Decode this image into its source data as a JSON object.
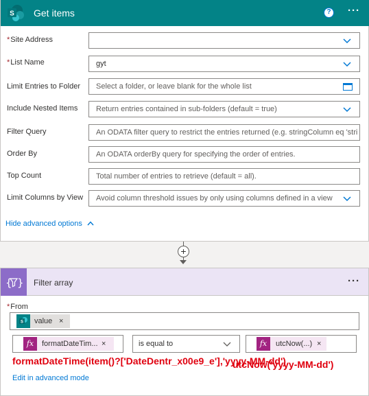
{
  "get_items": {
    "title": "Get items",
    "help_glyph": "?",
    "more_glyph": "···",
    "required_mark": "*",
    "fields": {
      "site_address": {
        "label": "Site Address",
        "value": ""
      },
      "list_name": {
        "label": "List Name",
        "value": "gyt"
      },
      "limit_folder": {
        "label": "Limit Entries to Folder",
        "placeholder": "Select a folder, or leave blank for the whole list"
      },
      "nested_items": {
        "label": "Include Nested Items",
        "placeholder": "Return entries contained in sub-folders (default = true)"
      },
      "filter_query": {
        "label": "Filter Query",
        "placeholder": "An ODATA filter query to restrict the entries returned (e.g. stringColumn eq 'stri"
      },
      "order_by": {
        "label": "Order By",
        "placeholder": "An ODATA orderBy query for specifying the order of entries."
      },
      "top_count": {
        "label": "Top Count",
        "placeholder": "Total number of entries to retrieve (default = all)."
      },
      "limit_columns": {
        "label": "Limit Columns by View",
        "placeholder": "Avoid column threshold issues by only using columns defined in a view"
      }
    },
    "hide_advanced": "Hide advanced options"
  },
  "connector": {
    "plus_glyph": "+"
  },
  "filter_array": {
    "title": "Filter array",
    "more_glyph": "···",
    "from_label": "From",
    "from_token": "value",
    "left_token": "formatDateTim...",
    "operator": "is equal to",
    "right_token": "utcNow(...)",
    "token_close": "×",
    "edit_advanced": "Edit in advanced mode"
  },
  "annotations": {
    "right": "utcNow('yyyy-MM-dd')",
    "bottom": "formatDateTime(item()?['DateDentr_x00e9_e'],'yyyy-MM-dd')"
  },
  "colors": {
    "sharepoint_teal": "#038387",
    "filter_purple": "#8c6cc8",
    "filter_header_bg": "#ebe4f5",
    "expression_magenta": "#a22381",
    "link_blue": "#0078d4",
    "annotation_red": "#e0000f"
  },
  "icons": [
    "sharepoint-icon",
    "help-icon",
    "more-icon",
    "chevron-down-icon",
    "folder-icon",
    "chevron-up-icon",
    "plus-icon",
    "filter-array-icon",
    "fx-icon",
    "close-icon"
  ]
}
